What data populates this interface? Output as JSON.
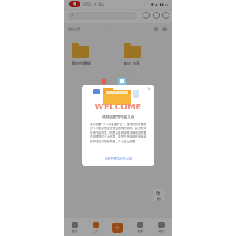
{
  "status_bar": {
    "indicator": "●",
    "info": "10:55 · 0.1K/s",
    "icons": "✱ ▲ ▮▮ ▭"
  },
  "section": {
    "title": "我的文件",
    "caret": "⌄"
  },
  "folders": [
    {
      "label": "我的应用数据"
    },
    {
      "label": "来自：分享",
      "sublabel": ""
    }
  ],
  "dialog": {
    "close": "×",
    "welcome": "WELCOME",
    "title": "欢迎您使用阿里云盘",
    "body": "我们依据“个人信息保护法”，要求所有收集您的个人信息的企业提供透明的说明，并对相关处理作出同意。阿里云盘将按照法律法规的要求处理您的个人信息，请您在使用前仔细阅读相关协议和隐私政策，并以此为依据",
    "link": "同意并使用阿里云盘"
  },
  "fab": {
    "icon": "⧉",
    "label": "备份"
  },
  "bottom_nav": {
    "items": [
      {
        "label": "首页"
      },
      {
        "label": "文件"
      },
      {
        "label": "+"
      },
      {
        "label": "相册"
      },
      {
        "label": "我的"
      }
    ]
  },
  "colors": {
    "accent": "#e8761f",
    "welcome": "#f08a7e",
    "folder": "#f6b63b"
  }
}
